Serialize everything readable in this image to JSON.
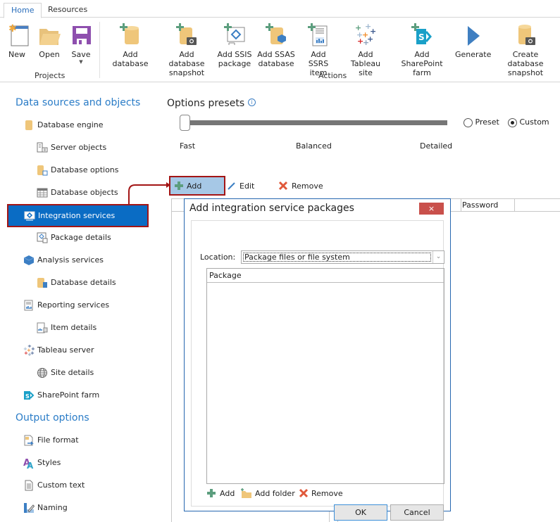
{
  "ribbon": {
    "tabs": [
      {
        "label": "Home",
        "active": true
      },
      {
        "label": "Resources",
        "active": false
      }
    ],
    "projects_group": {
      "label": "Projects",
      "buttons": [
        {
          "label": "New",
          "icon": "new-file-icon"
        },
        {
          "label": "Open",
          "icon": "folder-open-icon"
        },
        {
          "label": "Save",
          "icon": "save-icon",
          "has_dropdown": true
        }
      ]
    },
    "actions_group": {
      "label": "Actions",
      "buttons": [
        {
          "label_line1": "Add database",
          "label_line2": "",
          "icon": "add-database-icon"
        },
        {
          "label_line1": "Add database",
          "label_line2": "snapshot",
          "icon": "add-database-snapshot-icon"
        },
        {
          "label_line1": "Add SSIS",
          "label_line2": "package",
          "icon": "add-ssis-package-icon"
        },
        {
          "label_line1": "Add SSAS",
          "label_line2": "database",
          "icon": "add-ssas-database-icon"
        },
        {
          "label_line1": "Add SSRS",
          "label_line2": "item",
          "icon": "add-ssrs-item-icon"
        },
        {
          "label_line1": "Add Tableau",
          "label_line2": "site",
          "icon": "add-tableau-site-icon"
        },
        {
          "label_line1": "Add SharePoint",
          "label_line2": "farm",
          "icon": "add-sharepoint-farm-icon"
        },
        {
          "label_line1": "Generate",
          "label_line2": "",
          "icon": "play-icon"
        },
        {
          "label_line1": "Create database",
          "label_line2": "snapshot",
          "icon": "create-database-snapshot-icon"
        }
      ]
    }
  },
  "sidebar": {
    "data_sources_title": "Data sources and objects",
    "items": [
      {
        "label": "Database engine",
        "level": 0
      },
      {
        "label": "Server objects",
        "level": 1
      },
      {
        "label": "Database options",
        "level": 1
      },
      {
        "label": "Database objects",
        "level": 1
      },
      {
        "label": "Integration services",
        "level": 0,
        "selected": true
      },
      {
        "label": "Package details",
        "level": 1
      },
      {
        "label": "Analysis services",
        "level": 0
      },
      {
        "label": "Database details",
        "level": 1
      },
      {
        "label": "Reporting services",
        "level": 0
      },
      {
        "label": "Item details",
        "level": 1
      },
      {
        "label": "Tableau server",
        "level": 0
      },
      {
        "label": "Site details",
        "level": 1
      },
      {
        "label": "SharePoint farm",
        "level": 0
      }
    ],
    "output_title": "Output options",
    "output_items": [
      {
        "label": "File format"
      },
      {
        "label": "Styles"
      },
      {
        "label": "Custom text"
      },
      {
        "label": "Naming"
      }
    ]
  },
  "options": {
    "title": "Options presets",
    "slider_labels": [
      "Fast",
      "Balanced",
      "Detailed"
    ],
    "slider_value": "Fast",
    "radio_preset": "Preset",
    "radio_custom": "Custom",
    "selected_mode": "Custom"
  },
  "toolbar": {
    "add": "Add",
    "edit": "Edit",
    "remove": "Remove"
  },
  "grid": {
    "columns": [
      "",
      "Password",
      ""
    ]
  },
  "dialog": {
    "title": "Add integration service packages",
    "close": "×",
    "location_label": "Location:",
    "location_value": "Package files or file system",
    "list_header": "Package",
    "actions": {
      "add": "Add",
      "add_folder": "Add folder",
      "remove": "Remove"
    },
    "ok": "OK",
    "cancel": "Cancel"
  },
  "colors": {
    "accent": "#2a7cc7",
    "selected_bg": "#0a6cc4",
    "highlight_border": "#a31515",
    "close_bg": "#c9504b"
  }
}
